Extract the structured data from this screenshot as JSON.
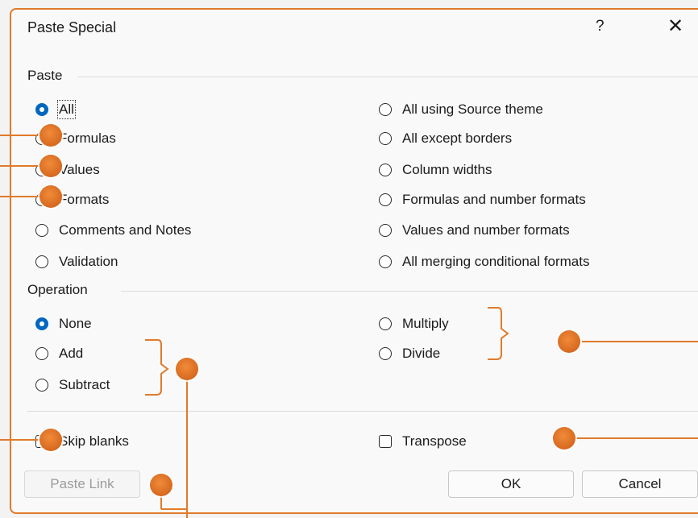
{
  "dialog": {
    "title": "Paste Special",
    "help_label": "?",
    "close_label": "✕"
  },
  "paste": {
    "group_label": "Paste",
    "left_options": [
      {
        "label": "All",
        "selected": true
      },
      {
        "label": "Formulas"
      },
      {
        "label": "Values"
      },
      {
        "label": "Formats"
      },
      {
        "label": "Comments and Notes"
      },
      {
        "label": "Validation"
      }
    ],
    "right_options": [
      {
        "label": "All using Source theme"
      },
      {
        "label": "All except borders"
      },
      {
        "label": "Column widths"
      },
      {
        "label": "Formulas and number formats"
      },
      {
        "label": "Values and number formats"
      },
      {
        "label": "All merging conditional formats"
      }
    ]
  },
  "operation": {
    "group_label": "Operation",
    "left_options": [
      {
        "label": "None",
        "selected": true
      },
      {
        "label": "Add"
      },
      {
        "label": "Subtract"
      }
    ],
    "right_options": [
      {
        "label": "Multiply"
      },
      {
        "label": "Divide"
      }
    ]
  },
  "checks": {
    "skip_blanks": "Skip blanks",
    "transpose": "Transpose"
  },
  "buttons": {
    "paste_link": "Paste Link",
    "ok": "OK",
    "cancel": "Cancel"
  },
  "colors": {
    "accent": "#0067c0",
    "annotation": "#e07a2a"
  }
}
